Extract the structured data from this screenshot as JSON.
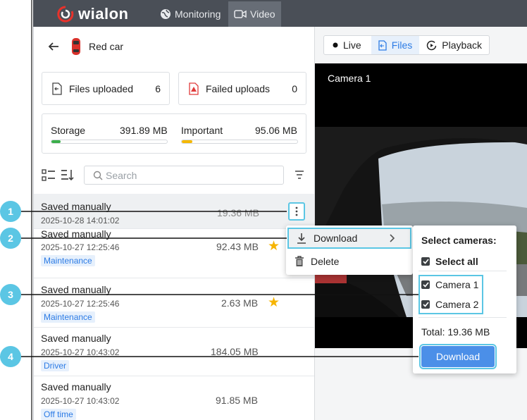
{
  "topbar": {
    "brand": "wialon",
    "nav": [
      {
        "label": "Monitoring",
        "icon": "globe-icon"
      },
      {
        "label": "Video",
        "icon": "video-icon"
      }
    ],
    "colors": {
      "bg": "#4a4f57",
      "active": "#676d76"
    }
  },
  "unit": {
    "name": "Red car"
  },
  "stats": {
    "files_uploaded": {
      "label": "Files uploaded",
      "value": "6"
    },
    "failed_uploads": {
      "label": "Failed uploads",
      "value": "0"
    }
  },
  "storage": {
    "storage_label": "Storage",
    "storage_value": "391.89 MB",
    "storage_fill": 0.08,
    "important_label": "Important",
    "important_value": "95.06 MB",
    "important_fill": 0.09,
    "storage_color": "#3aae4a",
    "important_color": "#f5b800"
  },
  "search": {
    "placeholder": "Search"
  },
  "files": [
    {
      "title": "Saved manually",
      "date": "2025-10-28 14:01:02",
      "size": "19.36 MB",
      "tag": "",
      "starred": false
    },
    {
      "title": "Saved manually",
      "date": "2025-10-27 12:25:46",
      "size": "92.43 MB",
      "tag": "Maintenance",
      "starred": true
    },
    {
      "title": "Saved manually",
      "date": "2025-10-27 12:25:46",
      "size": "2.63 MB",
      "tag": "Maintenance",
      "starred": true
    },
    {
      "title": "Saved manually",
      "date": "2025-10-27 10:43:02",
      "size": "184.05 MB",
      "tag": "Driver",
      "starred": false
    },
    {
      "title": "Saved manually",
      "date": "2025-10-27 10:43:02",
      "size": "91.85 MB",
      "tag": "Off time",
      "starred": false
    }
  ],
  "tabs": [
    {
      "label": "Live",
      "icon": "dot-icon"
    },
    {
      "label": "Files",
      "icon": "file-icon"
    },
    {
      "label": "Playback",
      "icon": "playback-icon"
    }
  ],
  "video": {
    "camera_label": "Camera 1"
  },
  "menu": {
    "download": "Download",
    "delete": "Delete"
  },
  "cameras_popup": {
    "title": "Select cameras:",
    "select_all": "Select all",
    "cameras": [
      "Camera 1",
      "Camera 2"
    ],
    "total": "Total: 19.36 MB",
    "download_button": "Download"
  },
  "callouts": [
    "1",
    "2",
    "3",
    "4"
  ],
  "accent": "#5bc6e4"
}
